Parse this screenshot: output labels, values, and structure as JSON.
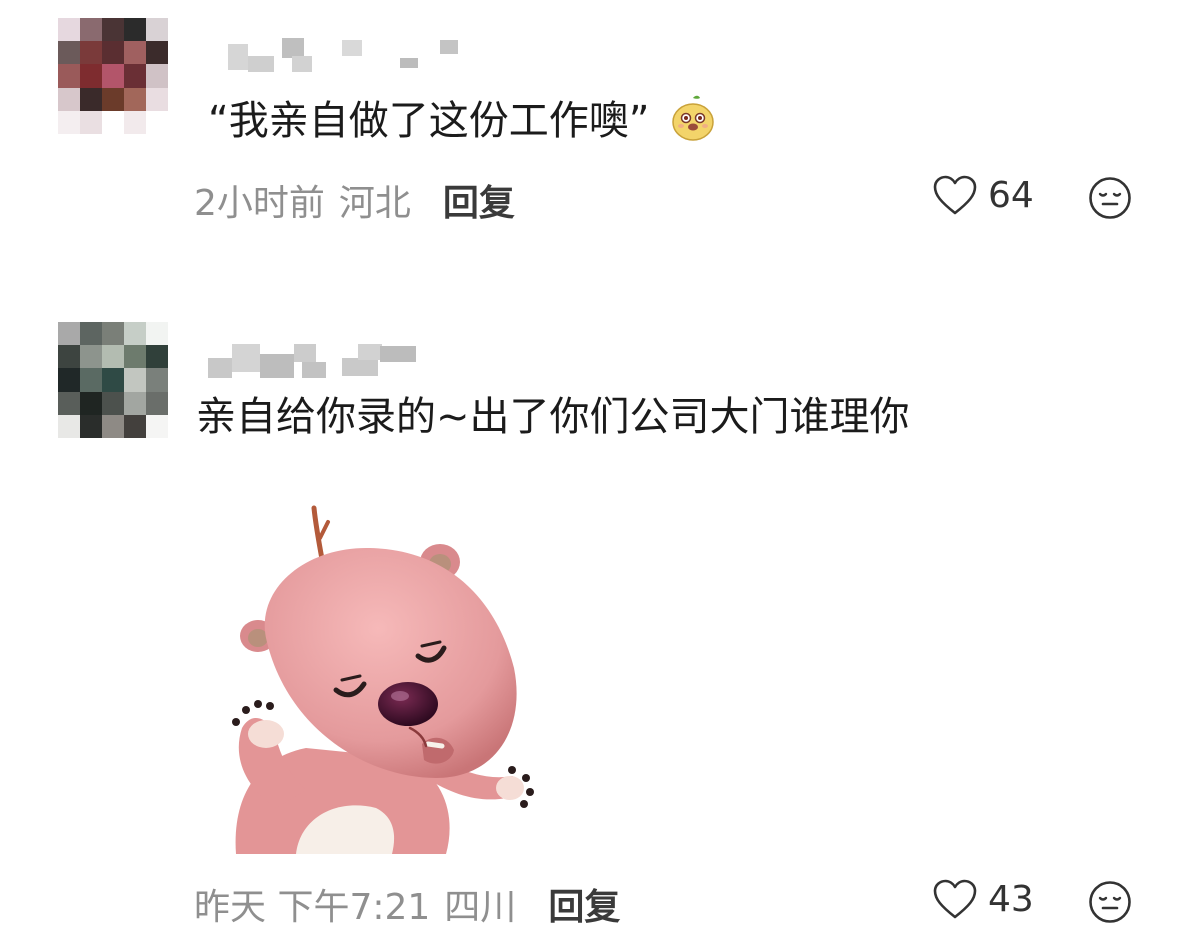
{
  "comments": [
    {
      "text": "“我亲自做了这份工作噢”",
      "inline_emoji": "yellow-pear-face-emoji",
      "time": "2小时前",
      "location": "河北",
      "reply_label": "回复",
      "like_count": "64",
      "avatar_colors": [
        "#e6d8df",
        "#8a6a6f",
        "#4a3435",
        "#2b2b2b",
        "#d9d2d5",
        "#6b5a5a",
        "#7a3a3a",
        "#5a2e31",
        "#a06060",
        "#3b2b2b",
        "#9a5a5a",
        "#7e2c2f",
        "#b3556a",
        "#6a2f35",
        "#d0c2c6",
        "#d7c7cb",
        "#3a2a2a",
        "#6b3b2a",
        "#a2675a",
        "#e9dde1",
        "#f4eef0",
        "#eadfe2",
        "#ffffff",
        "#f2eaec",
        "#ffffff"
      ]
    },
    {
      "text": "亲自给你录的~出了你们公司大门谁理你",
      "time": "昨天 下午7:21",
      "location": "四川",
      "reply_label": "回复",
      "like_count": "43",
      "sticker": "pink-beaver-loopy-sigh-sticker",
      "avatar_colors": [
        "#a9a9a9",
        "#5d6561",
        "#7a7f78",
        "#c6cec7",
        "#f2f4f2",
        "#3d4440",
        "#8d948d",
        "#b3bcb1",
        "#6d7b6d",
        "#30403a",
        "#202828",
        "#5a6a63",
        "#2f4a45",
        "#c2c6c0",
        "#7a807b",
        "#595e5a",
        "#1f2522",
        "#4c514d",
        "#a2a6a1",
        "#6a6e6a",
        "#e8e8e6",
        "#2a2d2b",
        "#8e8a85",
        "#43403d",
        "#f5f5f4"
      ]
    }
  ],
  "colors": {
    "meta_text": "#8f8f8f",
    "reply_text": "#3a3a3a",
    "body_text": "#1b1b1b",
    "sticker_pink": "#e9a3a5"
  },
  "icons": {
    "like": "heart-outline-icon",
    "dislike": "meh-face-icon"
  }
}
